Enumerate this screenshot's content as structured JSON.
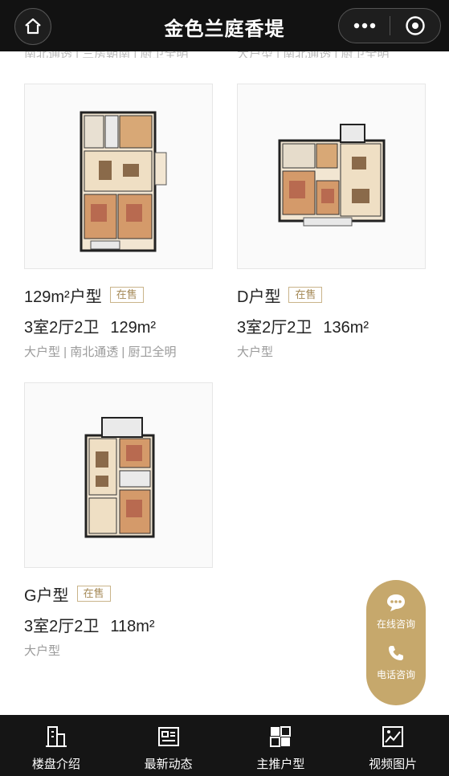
{
  "header": {
    "title": "金色兰庭香堤"
  },
  "cutoff": {
    "left": "南北通透 | 三房朝南 | 厨卫全明",
    "right": "大户型 | 南北通透 | 厨卫全明"
  },
  "units": [
    {
      "name": "129m²户型",
      "status": "在售",
      "layout": "3室2厅2卫",
      "area": "129m²",
      "tags": "大户型 | 南北通透 | 厨卫全明"
    },
    {
      "name": "D户型",
      "status": "在售",
      "layout": "3室2厅2卫",
      "area": "136m²",
      "tags": "大户型"
    },
    {
      "name": "G户型",
      "status": "在售",
      "layout": "3室2厅2卫",
      "area": "118m²",
      "tags": "大户型"
    }
  ],
  "consult": {
    "online": "在线咨询",
    "phone": "电话咨询"
  },
  "tabs": [
    {
      "label": "楼盘介绍",
      "icon": "building-icon"
    },
    {
      "label": "最新动态",
      "icon": "news-icon"
    },
    {
      "label": "主推户型",
      "icon": "floorplan-icon"
    },
    {
      "label": "视频图片",
      "icon": "image-icon"
    }
  ],
  "colors": {
    "header_bg": "#121212",
    "accent_gold": "#c6a86c",
    "badge_text": "#a58a58",
    "tab_bg": "#151515"
  }
}
